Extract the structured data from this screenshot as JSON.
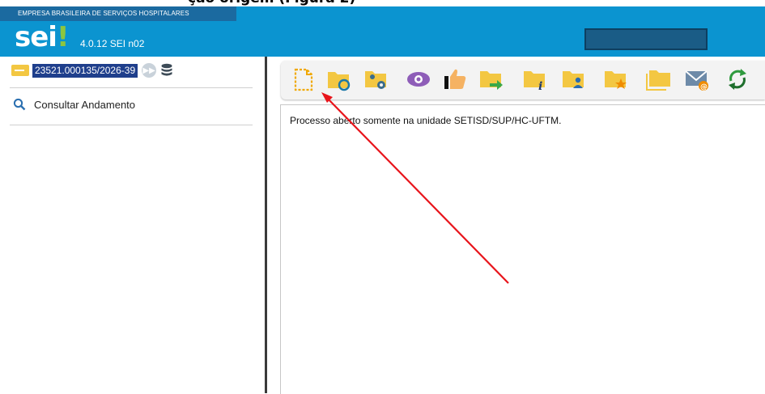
{
  "header": {
    "org_name": "EMPRESA BRASILEIRA DE SERVIÇOS HOSPITALARES",
    "logo_text": "sei",
    "logo_mark": "!",
    "version": "4.0.12 SEI n02"
  },
  "sidebar": {
    "process_number": "23521.000135/2026-39",
    "consult_label": "Consultar Andamento"
  },
  "toolbar": {
    "icons": [
      "new-document-icon",
      "process-relation-icon",
      "assign-process-icon",
      "view-icon",
      "send-process-icon",
      "update-process-icon",
      "process-info-icon",
      "assign-user-icon",
      "highlight-icon",
      "conclude-process-icon",
      "email-icon",
      "refresh-icon"
    ]
  },
  "content": {
    "status_text": "Processo aberto somente na unidade SETISD/SUP/HC-UFTM."
  },
  "colors": {
    "header_blue": "#0b94d0",
    "folder_yellow": "#f3c742",
    "arrow_red": "#e8141b"
  }
}
